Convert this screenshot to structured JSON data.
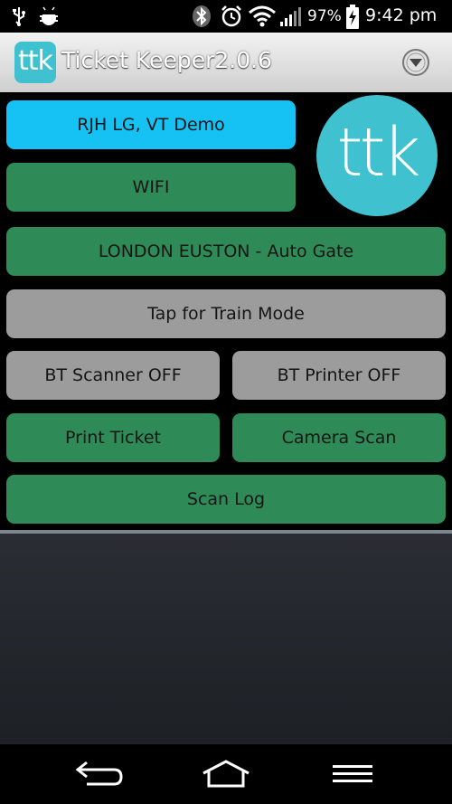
{
  "status_bar": {
    "battery": "97%",
    "time": "9:42 pm",
    "icons": [
      "usb-icon",
      "android-debug-icon",
      "bluetooth-icon",
      "alarm-icon",
      "wifi-icon",
      "signal-icon",
      "battery-charging-icon"
    ]
  },
  "action_bar": {
    "logo_text": "ttk",
    "title": "Ticket Keeper2.0.6",
    "overflow_icon": "overflow-menu-icon"
  },
  "main": {
    "logo_text": "ttk",
    "account_button": "RJH LG, VT Demo",
    "wifi_button": "WIFI",
    "station_button": "LONDON EUSTON - Auto Gate",
    "train_mode_button": "Tap for Train Mode",
    "bt_scanner_button": "BT Scanner OFF",
    "bt_printer_button": "BT Printer OFF",
    "print_ticket_button": "Print Ticket",
    "camera_scan_button": "Camera Scan",
    "scan_log_button": "Scan Log"
  },
  "colors": {
    "accent_blue": "#16c2f4",
    "green": "#2e8b57",
    "grey": "#9c9c9c",
    "logo": "#3fc1cf"
  },
  "nav_bar": {
    "icons": [
      "back-icon",
      "home-icon",
      "menu-icon"
    ]
  }
}
